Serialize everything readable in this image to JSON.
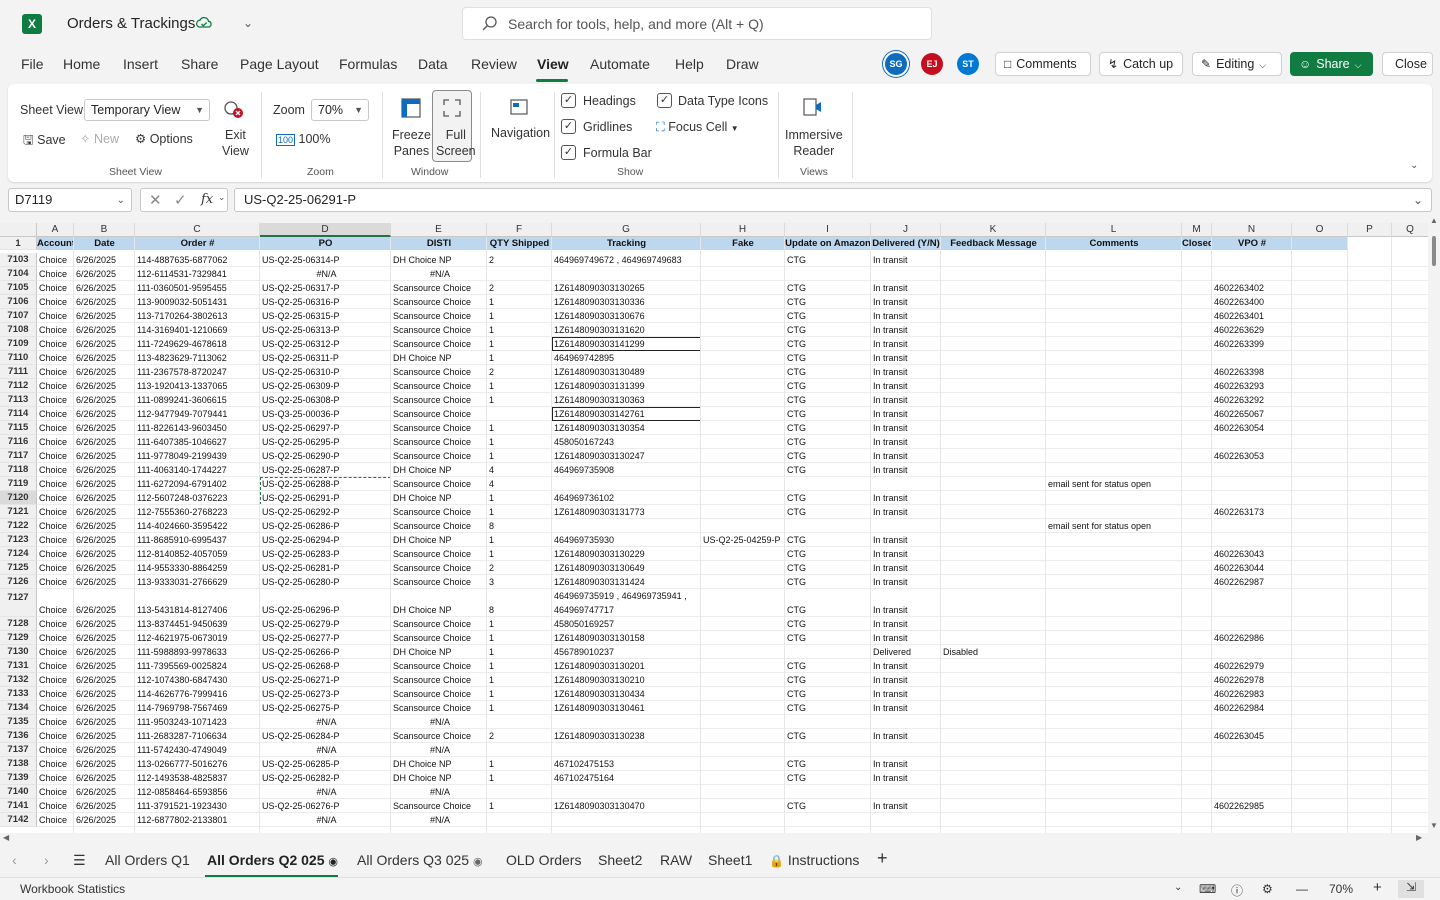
{
  "app": {
    "logo": "X",
    "title": "Orders & Trackings",
    "cloud_icon": "cloud-check-icon"
  },
  "search": {
    "placeholder": "Search for tools, help, and more (Alt + Q)"
  },
  "menu": [
    "File",
    "Home",
    "Insert",
    "Share",
    "Page Layout",
    "Formulas",
    "Data",
    "Review",
    "View",
    "Automate",
    "Help",
    "Draw"
  ],
  "menu_active": "View",
  "avatars": [
    {
      "initials": "SG",
      "color": "#0f6cbd"
    },
    {
      "initials": "EJ",
      "color": "#c50f1f"
    },
    {
      "initials": "ST",
      "color": "#0078d4"
    }
  ],
  "toolbar": {
    "comments": "Comments",
    "catch_up": "Catch up",
    "editing": "Editing",
    "share": "Share",
    "close": "Close"
  },
  "ribbon": {
    "sheet_view_label": "Sheet View",
    "sheet_view_value": "Temporary View",
    "save": "Save",
    "new": "New",
    "options": "Options",
    "exit_view": "Exit\nView",
    "group_sheet_view": "Sheet View",
    "zoom_label": "Zoom",
    "zoom_value": "70%",
    "zoom_100": "100%",
    "group_zoom": "Zoom",
    "freeze_panes": "Freeze\nPanes",
    "full_screen": "Full\nScreen",
    "group_window": "Window",
    "navigation": "Navigation",
    "headings": "Headings",
    "gridlines": "Gridlines",
    "formula_bar": "Formula Bar",
    "data_type_icons": "Data Type Icons",
    "focus_cell": "Focus Cell",
    "group_show": "Show",
    "immersive_reader": "Immersive\nReader",
    "group_views": "Views"
  },
  "formula_bar": {
    "name_box": "D7119",
    "fx": "fx",
    "value": "US-Q2-25-06291-P"
  },
  "columns": [
    {
      "letter": "A",
      "width": 37
    },
    {
      "letter": "B",
      "width": 61
    },
    {
      "letter": "C",
      "width": 125
    },
    {
      "letter": "D",
      "width": 131
    },
    {
      "letter": "E",
      "width": 96
    },
    {
      "letter": "F",
      "width": 65
    },
    {
      "letter": "G",
      "width": 149
    },
    {
      "letter": "H",
      "width": 84
    },
    {
      "letter": "I",
      "width": 86
    },
    {
      "letter": "J",
      "width": 70
    },
    {
      "letter": "K",
      "width": 105
    },
    {
      "letter": "L",
      "width": 136
    },
    {
      "letter": "M",
      "width": 30
    },
    {
      "letter": "N",
      "width": 80
    },
    {
      "letter": "O",
      "width": 56
    },
    {
      "letter": "P",
      "width": 44
    },
    {
      "letter": "Q",
      "width": 37
    }
  ],
  "header_row": {
    "num": "1",
    "cells": [
      "Account",
      "Date",
      "Order #",
      "PO",
      "DISTI",
      "QTY Shipped",
      "Tracking",
      "Fake",
      "Update on Amazon",
      "Delivered (Y/N)",
      "Feedback Message",
      "Comments",
      "Closed",
      "VPO #",
      "",
      "",
      ""
    ]
  },
  "rows": [
    [
      "7103",
      "Choice",
      "6/26/2025",
      "114-4887635-6877062",
      "US-Q2-25-06314-P",
      "DH Choice NP",
      "2",
      "464969749672 , 464969749683",
      "",
      "CTG",
      "In transit",
      "",
      "",
      "",
      ""
    ],
    [
      "7104",
      "Choice",
      "6/26/2025",
      "112-6114531-7329841",
      "#N/A",
      "#N/A",
      "",
      "",
      "",
      "",
      "",
      "",
      "",
      "",
      ""
    ],
    [
      "7105",
      "Choice",
      "6/26/2025",
      "111-0360501-9595455",
      "US-Q2-25-06317-P",
      "Scansource Choice",
      "2",
      "1Z6148090303130265",
      "",
      "CTG",
      "In transit",
      "",
      "",
      "",
      "4602263402"
    ],
    [
      "7106",
      "Choice",
      "6/26/2025",
      "113-9009032-5051431",
      "US-Q2-25-06316-P",
      "Scansource Choice",
      "1",
      "1Z6148090303130336",
      "",
      "CTG",
      "In transit",
      "",
      "",
      "",
      "4602263400"
    ],
    [
      "7107",
      "Choice",
      "6/26/2025",
      "113-7170264-3802613",
      "US-Q2-25-06315-P",
      "Scansource Choice",
      "1",
      "1Z6148090303130676",
      "",
      "CTG",
      "In transit",
      "",
      "",
      "",
      "4602263401"
    ],
    [
      "7108",
      "Choice",
      "6/26/2025",
      "114-3169401-1210669",
      "US-Q2-25-06313-P",
      "Scansource Choice",
      "1",
      "1Z6148090303131620",
      "",
      "CTG",
      "In transit",
      "",
      "",
      "",
      "4602263629"
    ],
    [
      "7109",
      "Choice",
      "6/26/2025",
      "111-7249629-4678618",
      "US-Q2-25-06312-P",
      "Scansource Choice",
      "1",
      "1Z6148090303141299",
      "",
      "CTG",
      "In transit",
      "",
      "",
      "",
      "4602263399"
    ],
    [
      "7110",
      "Choice",
      "6/26/2025",
      "113-4823629-7113062",
      "US-Q2-25-06311-P",
      "DH Choice NP",
      "1",
      "464969742895",
      "",
      "CTG",
      "In transit",
      "",
      "",
      "",
      ""
    ],
    [
      "7111",
      "Choice",
      "6/26/2025",
      "111-2367578-8720247",
      "US-Q2-25-06310-P",
      "Scansource Choice",
      "2",
      "1Z6148090303130489",
      "",
      "CTG",
      "In transit",
      "",
      "",
      "",
      "4602263398"
    ],
    [
      "7112",
      "Choice",
      "6/26/2025",
      "113-1920413-1337065",
      "US-Q2-25-06309-P",
      "Scansource Choice",
      "1",
      "1Z6148090303131399",
      "",
      "CTG",
      "In transit",
      "",
      "",
      "",
      "4602263293"
    ],
    [
      "7113",
      "Choice",
      "6/26/2025",
      "111-0899241-3606615",
      "US-Q2-25-06308-P",
      "Scansource Choice",
      "1",
      "1Z6148090303130363",
      "",
      "CTG",
      "In transit",
      "",
      "",
      "",
      "4602263292"
    ],
    [
      "7114",
      "Choice",
      "6/26/2025",
      "112-9477949-7079441",
      "US-Q3-25-00036-P",
      "Scansource Choice",
      "",
      "1Z6148090303142761",
      "",
      "CTG",
      "In transit",
      "",
      "",
      "",
      "4602265067"
    ],
    [
      "7115",
      "Choice",
      "6/26/2025",
      "111-8226143-9603450",
      "US-Q2-25-06297-P",
      "Scansource Choice",
      "1",
      "1Z6148090303130354",
      "",
      "CTG",
      "In transit",
      "",
      "",
      "",
      "4602263054"
    ],
    [
      "7116",
      "Choice",
      "6/26/2025",
      "111-6407385-1046627",
      "US-Q2-25-06295-P",
      "Scansource Choice",
      "1",
      "458050167243",
      "",
      "CTG",
      "In transit",
      "",
      "",
      "",
      ""
    ],
    [
      "7117",
      "Choice",
      "6/26/2025",
      "111-9778049-2199439",
      "US-Q2-25-06290-P",
      "Scansource Choice",
      "1",
      "1Z6148090303130247",
      "",
      "CTG",
      "In transit",
      "",
      "",
      "",
      "4602263053"
    ],
    [
      "7118",
      "Choice",
      "6/26/2025",
      "111-4063140-1744227",
      "US-Q2-25-06287-P",
      "DH Choice NP",
      "4",
      "464969735908",
      "",
      "CTG",
      "In transit",
      "",
      "",
      "",
      ""
    ],
    [
      "7119",
      "Choice",
      "6/26/2025",
      "111-6272094-6791402",
      "US-Q2-25-06288-P",
      "Scansource Choice",
      "4",
      "",
      "",
      "",
      "",
      "",
      "email sent for status open",
      "",
      ""
    ],
    [
      "7120",
      "Choice",
      "6/26/2025",
      "112-5607248-0376223",
      "US-Q2-25-06291-P",
      "DH Choice NP",
      "1",
      "464969736102",
      "",
      "CTG",
      "In transit",
      "",
      "",
      "",
      ""
    ],
    [
      "7121",
      "Choice",
      "6/26/2025",
      "112-7555360-2768223",
      "US-Q2-25-06292-P",
      "Scansource Choice",
      "1",
      "1Z6148090303131773",
      "",
      "CTG",
      "In transit",
      "",
      "",
      "",
      "4602263173"
    ],
    [
      "7122",
      "Choice",
      "6/26/2025",
      "114-4024660-3595422",
      "US-Q2-25-06286-P",
      "Scansource Choice",
      "8",
      "",
      "",
      "",
      "",
      "",
      "email sent for status open",
      "",
      ""
    ],
    [
      "7123",
      "Choice",
      "6/26/2025",
      "111-8685910-6995437",
      "US-Q2-25-06294-P",
      "DH Choice NP",
      "1",
      "464969735930",
      "US-Q2-25-04259-P",
      "CTG",
      "In transit",
      "",
      "",
      "",
      ""
    ],
    [
      "7124",
      "Choice",
      "6/26/2025",
      "112-8140852-4057059",
      "US-Q2-25-06283-P",
      "Scansource Choice",
      "1",
      "1Z6148090303130229",
      "",
      "CTG",
      "In transit",
      "",
      "",
      "",
      "4602263043"
    ],
    [
      "7125",
      "Choice",
      "6/26/2025",
      "114-9553330-8864259",
      "US-Q2-25-06281-P",
      "Scansource Choice",
      "2",
      "1Z6148090303130649",
      "",
      "CTG",
      "In transit",
      "",
      "",
      "",
      "4602263044"
    ],
    [
      "7126",
      "Choice",
      "6/26/2025",
      "113-9333031-2766629",
      "US-Q2-25-06280-P",
      "Scansource Choice",
      "3",
      "1Z6148090303131424",
      "",
      "CTG",
      "In transit",
      "",
      "",
      "",
      "4602262987"
    ],
    [
      "7127",
      "Choice",
      "6/26/2025",
      "113-5431814-8127406",
      "US-Q2-25-06296-P",
      "DH Choice NP",
      "8",
      "464969735919 , 464969735941 ,\n464969747717",
      "",
      "CTG",
      "In transit",
      "",
      "",
      "",
      ""
    ],
    [
      "7128",
      "Choice",
      "6/26/2025",
      "113-8374451-9450639",
      "US-Q2-25-06279-P",
      "Scansource Choice",
      "1",
      "458050169257",
      "",
      "CTG",
      "In transit",
      "",
      "",
      "",
      ""
    ],
    [
      "7129",
      "Choice",
      "6/26/2025",
      "112-4621975-0673019",
      "US-Q2-25-06277-P",
      "Scansource Choice",
      "1",
      "1Z6148090303130158",
      "",
      "CTG",
      "In transit",
      "",
      "",
      "",
      "4602262986"
    ],
    [
      "7130",
      "Choice",
      "6/26/2025",
      "111-5988893-9978633",
      "US-Q2-25-06266-P",
      "DH Choice NP",
      "1",
      "456789010237",
      "",
      "",
      "Delivered",
      "Disabled",
      "",
      "",
      ""
    ],
    [
      "7131",
      "Choice",
      "6/26/2025",
      "111-7395569-0025824",
      "US-Q2-25-06268-P",
      "Scansource Choice",
      "1",
      "1Z6148090303130201",
      "",
      "CTG",
      "In transit",
      "",
      "",
      "",
      "4602262979"
    ],
    [
      "7132",
      "Choice",
      "6/26/2025",
      "112-1074380-6847430",
      "US-Q2-25-06271-P",
      "Scansource Choice",
      "1",
      "1Z6148090303130210",
      "",
      "CTG",
      "In transit",
      "",
      "",
      "",
      "4602262978"
    ],
    [
      "7133",
      "Choice",
      "6/26/2025",
      "114-4626776-7999416",
      "US-Q2-25-06273-P",
      "Scansource Choice",
      "1",
      "1Z6148090303130434",
      "",
      "CTG",
      "In transit",
      "",
      "",
      "",
      "4602262983"
    ],
    [
      "7134",
      "Choice",
      "6/26/2025",
      "114-7969798-7567469",
      "US-Q2-25-06275-P",
      "Scansource Choice",
      "1",
      "1Z6148090303130461",
      "",
      "CTG",
      "In transit",
      "",
      "",
      "",
      "4602262984"
    ],
    [
      "7135",
      "Choice",
      "6/26/2025",
      "111-9503243-1071423",
      "#N/A",
      "#N/A",
      "",
      "",
      "",
      "",
      "",
      "",
      "",
      "",
      ""
    ],
    [
      "7136",
      "Choice",
      "6/26/2025",
      "111-2683287-7106634",
      "US-Q2-25-06284-P",
      "Scansource Choice",
      "2",
      "1Z6148090303130238",
      "",
      "CTG",
      "In transit",
      "",
      "",
      "",
      "4602263045"
    ],
    [
      "7137",
      "Choice",
      "6/26/2025",
      "111-5742430-4749049",
      "#N/A",
      "#N/A",
      "",
      "",
      "",
      "",
      "",
      "",
      "",
      "",
      ""
    ],
    [
      "7138",
      "Choice",
      "6/26/2025",
      "113-0266777-5016276",
      "US-Q2-25-06285-P",
      "DH Choice NP",
      "1",
      "467102475153",
      "",
      "CTG",
      "In transit",
      "",
      "",
      "",
      ""
    ],
    [
      "7139",
      "Choice",
      "6/26/2025",
      "112-1493538-4825837",
      "US-Q2-25-06282-P",
      "DH Choice NP",
      "1",
      "467102475164",
      "",
      "CTG",
      "In transit",
      "",
      "",
      "",
      ""
    ],
    [
      "7140",
      "Choice",
      "6/26/2025",
      "112-0858464-6593856",
      "#N/A",
      "#N/A",
      "",
      "",
      "",
      "",
      "",
      "",
      "",
      "",
      ""
    ],
    [
      "7141",
      "Choice",
      "6/26/2025",
      "111-3791521-1923430",
      "US-Q2-25-06276-P",
      "Scansource Choice",
      "1",
      "1Z6148090303130470",
      "",
      "CTG",
      "In transit",
      "",
      "",
      "",
      "4602262985"
    ],
    [
      "7142",
      "Choice",
      "6/26/2025",
      "112-6877802-2133801",
      "#N/A",
      "#N/A",
      "",
      "",
      "",
      "",
      "",
      "",
      "",
      "",
      ""
    ]
  ],
  "sheets": [
    "All Orders Q1",
    "All Orders Q2 025",
    "All Orders Q3 025",
    "OLD Orders",
    "Sheet2",
    "RAW",
    "Sheet1",
    "Instructions"
  ],
  "active_sheet": "All Orders Q2 025",
  "status": {
    "left": "Workbook Statistics",
    "zoom": "70%"
  }
}
